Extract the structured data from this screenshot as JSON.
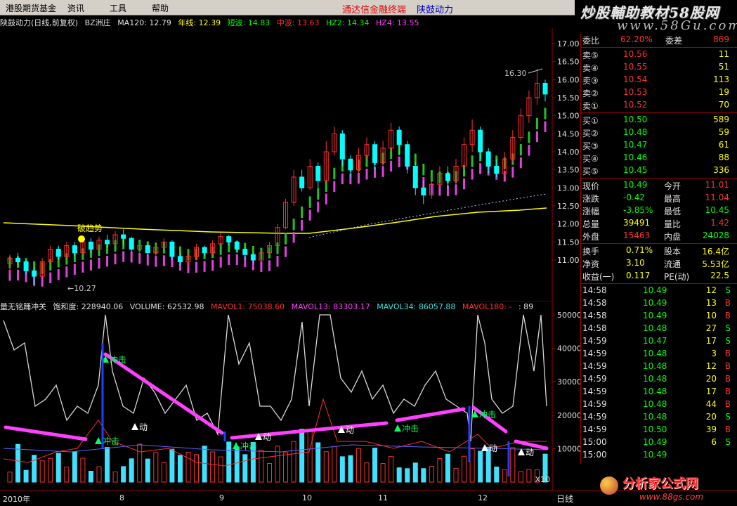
{
  "menu": {
    "items": [
      "港股期货基金",
      "资讯",
      "工具",
      "帮助"
    ],
    "center_title": "通达信金融终端",
    "center_subtitle": "陕鼓动力"
  },
  "brand": {
    "name": "炒股輔助教材58股网",
    "url": "www.58Gu.com"
  },
  "title_bar": {
    "stock": "陕鼓动力(日线,前复权)",
    "indicator": "BZ洲庄",
    "ma120": "MA120: 12.79",
    "nianxian": "年线: 12.39",
    "duanbo": "短波: 14.83",
    "zhongbo": "中波: 13.63",
    "hz2": "HZ2: 14.34",
    "hz4": "HZ4: 13.55"
  },
  "main_chart": {
    "price_axis": [
      "17.00",
      "16.50",
      "16.00",
      "15.50",
      "15.00",
      "14.50",
      "14.00",
      "13.50",
      "13.00",
      "12.50",
      "12.00",
      "11.50",
      "11.00"
    ],
    "high_label": "16.30",
    "low_label": "←10.27",
    "trend_label": "破趋势",
    "ymin": 10.8,
    "ymax": 17.2,
    "candles": [
      [
        10.9,
        11.05,
        10.6,
        11.15
      ],
      [
        11.05,
        10.95,
        10.85,
        11.2
      ],
      [
        10.95,
        10.7,
        10.6,
        11.0
      ],
      [
        10.7,
        10.55,
        10.27,
        10.8
      ],
      [
        10.55,
        10.95,
        10.5,
        11.05
      ],
      [
        10.95,
        11.3,
        10.9,
        11.4
      ],
      [
        11.3,
        11.1,
        11.0,
        11.4
      ],
      [
        11.1,
        11.4,
        11.05,
        11.5
      ],
      [
        11.4,
        11.2,
        11.1,
        11.5
      ],
      [
        11.2,
        11.5,
        11.15,
        11.6
      ],
      [
        11.5,
        11.3,
        11.2,
        11.6
      ],
      [
        11.3,
        11.55,
        11.25,
        11.65
      ],
      [
        11.55,
        11.45,
        11.35,
        11.7
      ],
      [
        11.45,
        11.7,
        11.4,
        11.8
      ],
      [
        11.7,
        11.6,
        11.4,
        11.85
      ],
      [
        11.6,
        11.3,
        11.2,
        11.65
      ],
      [
        11.3,
        11.4,
        11.2,
        11.5
      ],
      [
        11.4,
        11.2,
        11.1,
        11.45
      ],
      [
        11.2,
        11.35,
        11.1,
        11.45
      ],
      [
        11.35,
        11.5,
        11.3,
        11.6
      ],
      [
        11.5,
        11.1,
        11.0,
        11.55
      ],
      [
        11.1,
        10.95,
        10.85,
        11.2
      ],
      [
        10.95,
        11.1,
        10.8,
        11.2
      ],
      [
        11.1,
        11.35,
        11.0,
        11.45
      ],
      [
        11.35,
        11.2,
        11.1,
        11.4
      ],
      [
        11.2,
        11.45,
        11.15,
        11.55
      ],
      [
        11.45,
        11.65,
        11.4,
        11.75
      ],
      [
        11.65,
        11.5,
        11.4,
        11.7
      ],
      [
        11.5,
        11.3,
        11.2,
        11.55
      ],
      [
        11.3,
        11.15,
        11.0,
        11.35
      ],
      [
        11.15,
        11.0,
        10.9,
        11.2
      ],
      [
        11.0,
        11.2,
        10.95,
        11.3
      ],
      [
        11.2,
        11.4,
        11.1,
        11.5
      ],
      [
        11.4,
        11.9,
        11.35,
        12.0
      ],
      [
        11.9,
        12.6,
        11.85,
        12.7
      ],
      [
        12.6,
        13.3,
        12.5,
        13.5
      ],
      [
        13.3,
        13.0,
        12.9,
        13.5
      ],
      [
        13.0,
        13.6,
        12.95,
        13.8
      ],
      [
        13.6,
        13.2,
        13.0,
        13.7
      ],
      [
        13.2,
        14.0,
        13.15,
        14.3
      ],
      [
        14.0,
        14.5,
        13.9,
        14.7
      ],
      [
        14.5,
        13.8,
        13.6,
        14.6
      ],
      [
        13.8,
        13.5,
        13.3,
        13.9
      ],
      [
        13.5,
        13.9,
        13.4,
        14.1
      ],
      [
        13.9,
        14.2,
        13.8,
        14.4
      ],
      [
        14.2,
        13.7,
        13.5,
        14.3
      ],
      [
        13.7,
        14.1,
        13.6,
        14.3
      ],
      [
        14.1,
        14.6,
        14.0,
        14.8
      ],
      [
        14.6,
        14.2,
        13.9,
        14.7
      ],
      [
        14.2,
        13.6,
        13.4,
        14.3
      ],
      [
        13.6,
        13.0,
        12.8,
        13.7
      ],
      [
        13.0,
        12.8,
        12.55,
        13.2
      ],
      [
        12.8,
        13.1,
        12.7,
        13.3
      ],
      [
        13.1,
        13.4,
        13.0,
        13.6
      ],
      [
        13.4,
        13.2,
        13.0,
        13.6
      ],
      [
        13.2,
        13.6,
        13.1,
        13.8
      ],
      [
        13.6,
        14.2,
        13.5,
        14.4
      ],
      [
        14.2,
        14.6,
        14.0,
        14.9
      ],
      [
        14.6,
        14.0,
        13.8,
        14.7
      ],
      [
        14.0,
        13.6,
        13.4,
        14.1
      ],
      [
        13.6,
        13.4,
        13.3,
        13.8
      ],
      [
        13.4,
        13.8,
        13.3,
        14.0
      ],
      [
        13.8,
        14.4,
        13.7,
        14.6
      ],
      [
        14.4,
        15.0,
        14.3,
        15.2
      ],
      [
        15.0,
        15.5,
        14.8,
        15.7
      ],
      [
        15.5,
        15.9,
        15.3,
        16.3
      ],
      [
        15.9,
        15.6,
        15.4,
        16.0
      ]
    ]
  },
  "volume_chart": {
    "legend": {
      "name": "量无铭踊冲关",
      "saturation": "饱和度: 228940.06",
      "volume": "VOLUME: 62532.98",
      "mavol1": "MAVOL1: 75038.60",
      "mavol13": "MAVOL13: 83303.17",
      "mavol34": "MAVOL34: 86057.88",
      "mavol180": "MAVOL180: -",
      "extra": ": 89"
    },
    "axis": [
      "50000",
      "40000",
      "30000",
      "20000",
      "10000"
    ],
    "x10": "X10",
    "signals": [
      "冲击",
      "冲击",
      "冲击",
      "冲击",
      "冲击",
      "动",
      "动",
      "动",
      "动",
      "动"
    ]
  },
  "x_axis": {
    "labels": [
      "2010年",
      "8",
      "9",
      "10",
      "11",
      "12"
    ],
    "right_label": "日线"
  },
  "quote": {
    "top": {
      "label": "委比",
      "value": "62.20%",
      "label2": "委差",
      "value2": "869"
    },
    "sells": [
      {
        "label": "卖⑤",
        "price": "10.56",
        "vol": "11"
      },
      {
        "label": "卖④",
        "price": "10.55",
        "vol": "51"
      },
      {
        "label": "卖③",
        "price": "10.54",
        "vol": "113"
      },
      {
        "label": "卖②",
        "price": "10.53",
        "vol": "19"
      },
      {
        "label": "卖①",
        "price": "10.52",
        "vol": "70"
      }
    ],
    "buys": [
      {
        "label": "买①",
        "price": "10.50",
        "vol": "589"
      },
      {
        "label": "买②",
        "price": "10.48",
        "vol": "59"
      },
      {
        "label": "买③",
        "price": "10.47",
        "vol": "61"
      },
      {
        "label": "买④",
        "price": "10.46",
        "vol": "88"
      },
      {
        "label": "买⑤",
        "price": "10.45",
        "vol": "336"
      }
    ],
    "stats": [
      {
        "l1": "现价",
        "v1": "10.49",
        "c1": "#00ff00",
        "l2": "今开",
        "v2": "11.01",
        "c2": "#ff3030"
      },
      {
        "l1": "涨跌",
        "v1": "-0.42",
        "c1": "#00ff00",
        "l2": "最高",
        "v2": "11.04",
        "c2": "#ff3030"
      },
      {
        "l1": "涨幅",
        "v1": "-3.85%",
        "c1": "#00ff00",
        "l2": "最低",
        "v2": "10.45",
        "c2": "#00ff00"
      },
      {
        "l1": "总量",
        "v1": "39491",
        "c1": "#ffff00",
        "l2": "量比",
        "v2": "1.42",
        "c2": "#ff3030"
      },
      {
        "l1": "外盘",
        "v1": "15463",
        "c1": "#ff3030",
        "l2": "内盘",
        "v2": "24028",
        "c2": "#00ff00"
      }
    ],
    "stats2": [
      {
        "l1": "换手",
        "v1": "0.71%",
        "l2": "股本",
        "v2": "16.4亿"
      },
      {
        "l1": "净资",
        "v1": "3.10",
        "l2": "流通",
        "v2": "5.53亿"
      },
      {
        "l1": "收益(一)",
        "v1": "0.117",
        "l2": "PE(动)",
        "v2": "22.5"
      }
    ],
    "ticks": [
      {
        "t": "14:58",
        "p": "10.49",
        "v": "12",
        "s": "S"
      },
      {
        "t": "14:58",
        "p": "10.49",
        "v": "13",
        "s": "B"
      },
      {
        "t": "14:58",
        "p": "10.49",
        "v": "10",
        "s": "B"
      },
      {
        "t": "14:58",
        "p": "10.48",
        "v": "27",
        "s": "S"
      },
      {
        "t": "14:59",
        "p": "10.47",
        "v": "17",
        "s": "S"
      },
      {
        "t": "14:59",
        "p": "10.48",
        "v": "3",
        "s": "B"
      },
      {
        "t": "14:59",
        "p": "10.48",
        "v": "12",
        "s": "B"
      },
      {
        "t": "14:59",
        "p": "10.48",
        "v": "20",
        "s": "B"
      },
      {
        "t": "14:59",
        "p": "10.48",
        "v": "17",
        "s": "B"
      },
      {
        "t": "14:59",
        "p": "10.48",
        "v": "44",
        "s": "B"
      },
      {
        "t": "14:59",
        "p": "10.48",
        "v": "20",
        "s": "S"
      },
      {
        "t": "14:59",
        "p": "10.50",
        "v": "39",
        "s": "B"
      },
      {
        "t": "15:00",
        "p": "10.49",
        "v": "6",
        "s": "S"
      },
      {
        "t": "15:00",
        "p": "10.49",
        "v": "",
        "s": ""
      }
    ]
  },
  "footer_watermark": {
    "brand": "分析家公式网",
    "url": "www.88gs.com"
  },
  "colors": {
    "up": "#ff3030",
    "down": "#00ffff",
    "green": "#00ff00",
    "magenta": "#ff40ff",
    "yellow": "#ffff00",
    "axis_red": "#a00000"
  }
}
